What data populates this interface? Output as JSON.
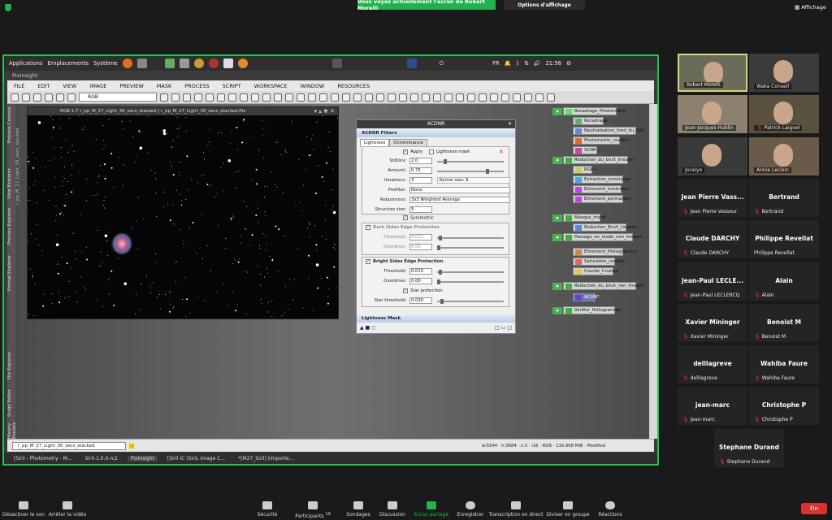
{
  "zoom_top": {
    "share_banner": "Vous voyez actuellement l'écran de Robert Morelli",
    "view_options": "Options d'affichage",
    "affichage": "Affichage"
  },
  "gnome": {
    "applications": "Applications",
    "emplacements": "Emplacements",
    "systeme": "Système",
    "lang": "FR",
    "clock": "21:56"
  },
  "pixinsight": {
    "title": "PixInsight",
    "menu": [
      "FILE",
      "EDIT",
      "VIEW",
      "IMAGE",
      "PREVIEW",
      "MASK",
      "PROCESS",
      "SCRIPT",
      "WORKSPACE",
      "WINDOW",
      "RESOURCES"
    ],
    "channel": "RGB",
    "left_tabs": [
      "Process Console",
      "View Explorer",
      "Process Explorer",
      "Format Explorer",
      "File Explorer",
      "Script Editor",
      "History Explorer"
    ],
    "image_window": {
      "title": "RGB 1:7  r_pp_M_27_Light_30_secs_stacked | r_pp_M_27_Light_30_secs_stacked.fits",
      "side_label": "r_pp_M_27_Light_30_secs_stacked"
    },
    "acdnr": {
      "title": "ACDNR",
      "section_filters": "ACDNR Filters",
      "tabs": [
        "Lightness",
        "Chrominance"
      ],
      "apply": "Apply",
      "lightness_mask": "Lightness mask",
      "stddev_label": "StdDev:",
      "stddev": "2.0",
      "amount_label": "Amount:",
      "amount": "0.75",
      "iterations_label": "Iterations:",
      "iterations": "3",
      "kernel": "Kernel size: 9",
      "prefilter_label": "Prefilter:",
      "prefilter": "None",
      "robustness_label": "Robustness:",
      "robustness": "3x3 Weighted Average",
      "structure_label": "Structure size:",
      "structure": "5",
      "symmetric": "Symmetric",
      "dark_title": "Dark Sides Edge Protection",
      "dark_threshold_label": "Threshold:",
      "dark_threshold": "0.015",
      "dark_overdrive_label": "Overdrive:",
      "dark_overdrive": "0.00",
      "bright_title": "Bright Sides Edge Protection",
      "bright_threshold_label": "Threshold:",
      "bright_threshold": "0.015",
      "bright_overdrive_label": "Overdrive:",
      "bright_overdrive": "0.00",
      "star_protection": "Star protection",
      "star_threshold_label": "Star threshold:",
      "star_threshold": "0.030",
      "section_mask": "Lightness Mask"
    },
    "processes": [
      {
        "label": "Recadrage_Photometrie",
        "grp": true
      },
      {
        "label": "Recadrage",
        "grp": false
      },
      {
        "label": "Neutralisation_fond_du_Ciel",
        "grp": false
      },
      {
        "label": "Photometrie_couleur",
        "grp": false
      },
      {
        "label": "SCNR",
        "grp": false
      },
      {
        "label": "Reduction_du_bruit_lineaire",
        "grp": true
      },
      {
        "label": "RGB",
        "grp": false
      },
      {
        "label": "Extraction_luminance",
        "grp": false
      },
      {
        "label": "Etirement_luminance",
        "grp": false
      },
      {
        "label": "Etirement_permanent",
        "grp": false
      },
      {
        "label": "Masque_invert",
        "grp": true
      },
      {
        "label": "Reduction_Bruit_Lineaire",
        "grp": false
      },
      {
        "label": "Passage_en_mode_non_lineaire",
        "grp": true
      },
      {
        "label": "Etirement_Histogramme",
        "grp": false
      },
      {
        "label": "Saturation_couleur",
        "grp": false
      },
      {
        "label": "Courbe_Couleur",
        "grp": false
      },
      {
        "label": "Reduction_du_bruit_non_lineaire",
        "grp": true
      },
      {
        "label": "ACDNR",
        "grp": false,
        "hi": true
      },
      {
        "label": "Verifier_Histogramme",
        "grp": true
      }
    ],
    "view_selector": "r_pp_M_27_Light_30_secs_stacked",
    "status": "w:5544  ·  h:3684  ·  n:3  ·  i16  ·  RGB  ·  116.868 MiB  ·  Modified",
    "taskbar": [
      "[Siril - Photometry - M...",
      "Siril-1.0.0-rc2",
      "PixInsight",
      "[Siril IC (SiriL Image C...",
      "*[M27_Siril] (importe..."
    ]
  },
  "participants": [
    {
      "name": "Robert Morelli",
      "video": true
    },
    {
      "name": "Waka Conseil",
      "video": true
    },
    {
      "name": "Jean-Jacques Hublin",
      "video": true
    },
    {
      "name": "Patrick Laignel",
      "video": true,
      "muted": true
    },
    {
      "name": "Jocelyn",
      "video": true
    },
    {
      "name": "Annie Leclerc",
      "video": true
    },
    {
      "big": "Jean Pierre Vass...",
      "name": "Jean Pierre Vasseur",
      "muted": true
    },
    {
      "big": "Bertrand",
      "name": "Bertrand",
      "muted": true
    },
    {
      "big": "Claude DARCHY",
      "name": "Claude DARCHY",
      "muted": true
    },
    {
      "big": "Philippe Revellat",
      "name": "Philippe Revellat",
      "muted": false
    },
    {
      "big": "Jean-Paul  LECLE...",
      "name": "Jean-Paul LECLERCQ",
      "muted": true
    },
    {
      "big": "Alain",
      "name": "Alain",
      "muted": true
    },
    {
      "big": "Xavier Mininger",
      "name": "Xavier Mininger",
      "muted": true
    },
    {
      "big": "Benoist M",
      "name": "Benoist M",
      "muted": true
    },
    {
      "big": "delllagreve",
      "name": "delllagreve",
      "muted": true
    },
    {
      "big": "Wahiba Faure",
      "name": "Wahiba Faure",
      "muted": true
    },
    {
      "big": "jean-marc",
      "name": "jean-marc",
      "muted": true
    },
    {
      "big": "Christophe P",
      "name": "Christophe P",
      "muted": true
    },
    {
      "big": "Stephane Durand",
      "name": "Stephane Durand",
      "muted": true
    }
  ],
  "zoom_bottom": {
    "mute": "Désactiver le son",
    "video": "Arrêter la vidéo",
    "security": "Sécurité",
    "participants": "Participants",
    "participants_count": "19",
    "polls": "Sondages",
    "chat": "Discussion",
    "share": "Écran partagé",
    "record": "Enregistrer",
    "transcript": "Transcription en direct",
    "breakout": "Diviser en groupe",
    "reactions": "Réactions",
    "end": "Fin"
  },
  "colors": {
    "zoom_green": "#23b14d",
    "end_red": "#d9312b",
    "acdnr_highlight": "#6c7ac2"
  }
}
